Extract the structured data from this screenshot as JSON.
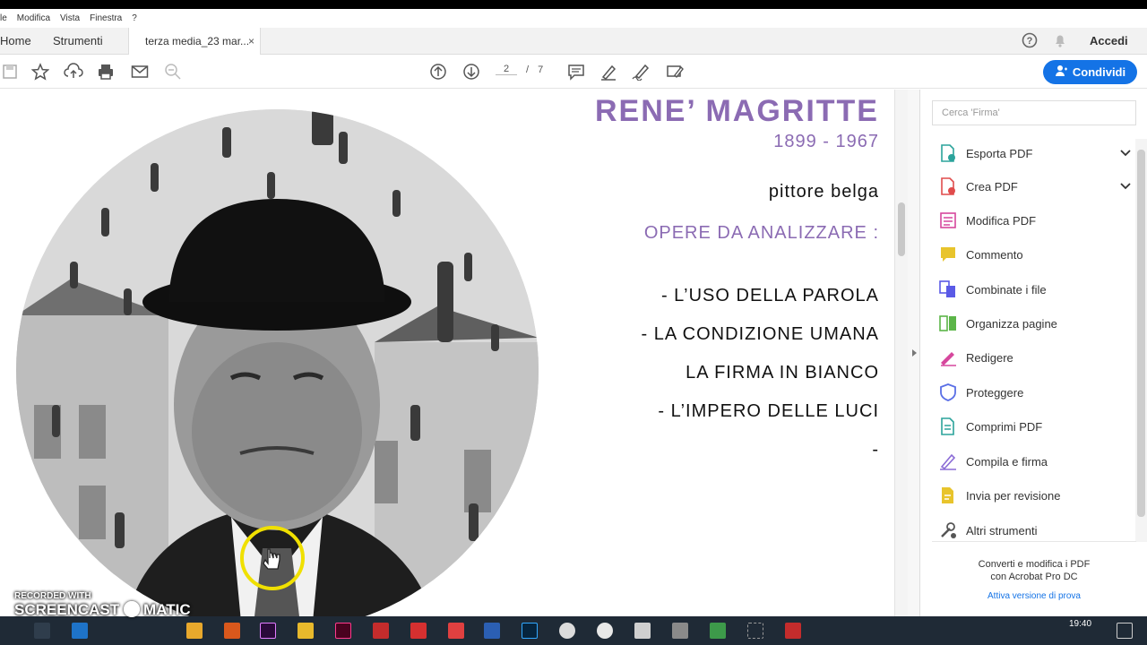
{
  "menu": [
    "le",
    "Modifica",
    "Vista",
    "Finestra",
    "?"
  ],
  "tabs": {
    "home": "Home",
    "tools": "Strumenti",
    "document": "terza media_23 mar...",
    "close": "×"
  },
  "account": {
    "signin": "Accedi",
    "help_icon": "help-icon",
    "bell_icon": "bell-icon"
  },
  "toolbar": {
    "page_current": "2",
    "page_sep": "/",
    "page_total": "7",
    "share": "Condividi"
  },
  "document": {
    "title": "RENE’ MAGRITTE",
    "years": "1899 - 1967",
    "subtitle": "pittore belga",
    "section": "OPERE DA ANALIZZARE :",
    "works": [
      "- L’USO DELLA PAROLA",
      "- LA CONDIZIONE UMANA",
      "LA FIRMA IN BIANCO",
      "- L’IMPERO DELLE LUCI",
      "-"
    ]
  },
  "panel": {
    "search_placeholder": "Cerca 'Firma'",
    "tools": [
      {
        "label": "Esporta PDF",
        "color": "#2ba39b",
        "expand": true
      },
      {
        "label": "Crea PDF",
        "color": "#e04c4c",
        "expand": true
      },
      {
        "label": "Modifica PDF",
        "color": "#d6479d"
      },
      {
        "label": "Commento",
        "color": "#e8c42c"
      },
      {
        "label": "Combinate i file",
        "color": "#5a5ae6"
      },
      {
        "label": "Organizza pagine",
        "color": "#5bb548"
      },
      {
        "label": "Redigere",
        "color": "#d6479d"
      },
      {
        "label": "Proteggere",
        "color": "#5a6fe6"
      },
      {
        "label": "Comprimi PDF",
        "color": "#2ba39b"
      },
      {
        "label": "Compila e firma",
        "color": "#8b6bd6"
      },
      {
        "label": "Invia per revisione",
        "color": "#e8c42c"
      },
      {
        "label": "Altri strumenti",
        "color": "#555555"
      }
    ],
    "promo_line1": "Converti e modifica i PDF",
    "promo_line2": "con Acrobat Pro DC",
    "promo_link": "Attiva versione di prova"
  },
  "watermark": {
    "line1": "RECORDED WITH",
    "line2": "SCREENCAST",
    "line3": "MATIC"
  },
  "taskbar": {
    "time": "19:40"
  }
}
